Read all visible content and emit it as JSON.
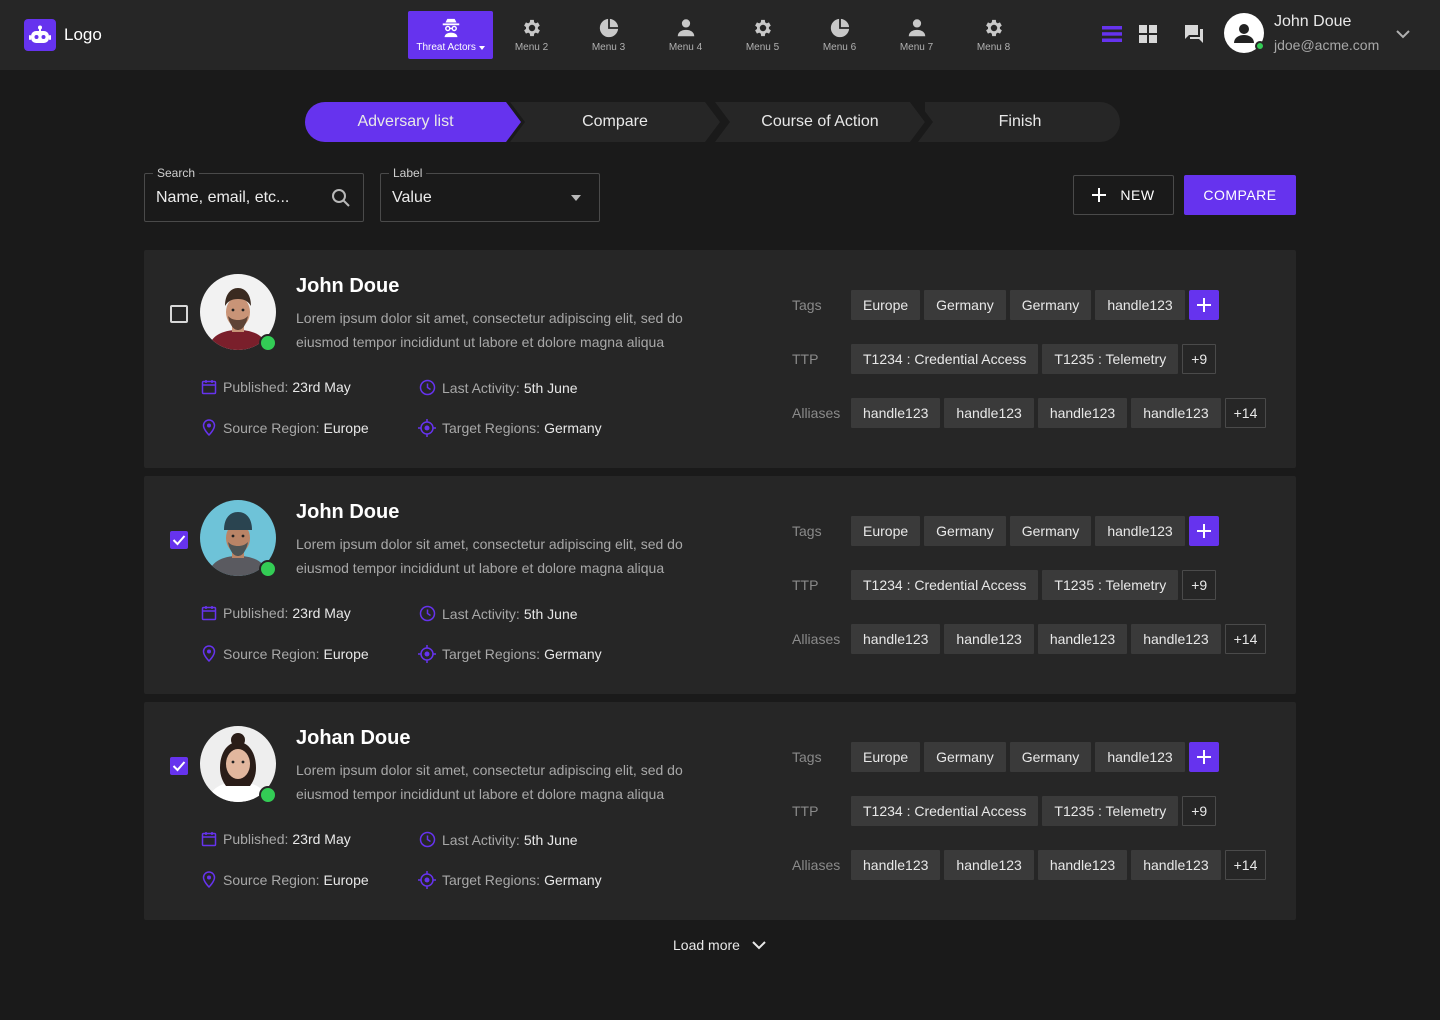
{
  "app": {
    "logo_text": "Logo"
  },
  "nav": {
    "items": [
      {
        "label": "Threat Actors",
        "icon": "spy-icon",
        "active": true
      },
      {
        "label": "Menu 2",
        "icon": "gear-icon"
      },
      {
        "label": "Menu 3",
        "icon": "pie-chart-icon"
      },
      {
        "label": "Menu 4",
        "icon": "person-icon"
      },
      {
        "label": "Menu 5",
        "icon": "gear-icon"
      },
      {
        "label": "Menu 6",
        "icon": "pie-chart-icon"
      },
      {
        "label": "Menu 7",
        "icon": "person-icon"
      },
      {
        "label": "Menu 8",
        "icon": "gear-icon"
      }
    ]
  },
  "user": {
    "name": "John Doue",
    "email": "jdoe@acme.com",
    "online": true
  },
  "stepper": {
    "steps": [
      "Adversary list",
      "Compare",
      "Course of Action",
      "Finish"
    ],
    "active_index": 0
  },
  "filters": {
    "search_label": "Search",
    "search_placeholder": "Name, email, etc...",
    "label_label": "Label",
    "label_value": "Value"
  },
  "actions": {
    "new_label": "NEW",
    "compare_label": "COMPARE"
  },
  "field_labels": {
    "published": "Published:",
    "last_activity": "Last Activity:",
    "source_region": "Source Region:",
    "target_regions": "Target Regions:",
    "tags": "Tags",
    "ttp": "TTP",
    "aliases": "Alliases"
  },
  "adversaries": [
    {
      "name": "John Doue",
      "checked": false,
      "description": "Lorem ipsum dolor sit amet, consectetur adipiscing elit, sed do eiusmod tempor incididunt ut labore et dolore magna aliqua",
      "published": "23rd May",
      "last_activity": "5th June",
      "source_region": "Europe",
      "target_regions": "Germany",
      "tags": [
        "Europe",
        "Germany",
        "Germany",
        "handle123"
      ],
      "ttp": [
        "T1234 : Credential Access",
        "T1235 : Telemetry"
      ],
      "ttp_more": "+9",
      "aliases": [
        "handle123",
        "handle123",
        "handle123",
        "handle123"
      ],
      "aliases_more": "+14",
      "avatar_colors": {
        "bg": "#f2f2f2",
        "skin": "#c99477",
        "hair": "#3a2a20",
        "shirt": "#7a1f2b"
      }
    },
    {
      "name": "John Doue",
      "checked": true,
      "description": "Lorem ipsum dolor sit amet, consectetur adipiscing elit, sed do eiusmod tempor incididunt ut labore et dolore magna aliqua",
      "published": "23rd May",
      "last_activity": "5th June",
      "source_region": "Europe",
      "target_regions": "Germany",
      "tags": [
        "Europe",
        "Germany",
        "Germany",
        "handle123"
      ],
      "ttp": [
        "T1234 : Credential Access",
        "T1235 : Telemetry"
      ],
      "ttp_more": "+9",
      "aliases": [
        "handle123",
        "handle123",
        "handle123",
        "handle123"
      ],
      "aliases_more": "+14",
      "avatar_colors": {
        "bg": "#6ec3d8",
        "skin": "#b98466",
        "hair": "#2a4450",
        "shirt": "#5a5a60"
      }
    },
    {
      "name": "Johan Doue",
      "checked": true,
      "description": "Lorem ipsum dolor sit amet, consectetur adipiscing elit, sed do eiusmod tempor incididunt ut labore et dolore magna aliqua",
      "published": "23rd May",
      "last_activity": "5th June",
      "source_region": "Europe",
      "target_regions": "Germany",
      "tags": [
        "Europe",
        "Germany",
        "Germany",
        "handle123"
      ],
      "ttp": [
        "T1234 : Credential Access",
        "T1235 : Telemetry"
      ],
      "ttp_more": "+9",
      "aliases": [
        "handle123",
        "handle123",
        "handle123",
        "handle123"
      ],
      "aliases_more": "+14",
      "avatar_colors": {
        "bg": "#eeeeee",
        "skin": "#e2b79e",
        "hair": "#2a1d18",
        "shirt": "#ffffff"
      }
    }
  ],
  "footer": {
    "load_more": "Load more"
  },
  "colors": {
    "accent": "#6633ee",
    "online": "#33cc55",
    "background": "#1a1a1a",
    "surface": "#262626",
    "chip": "#3a3a3a"
  }
}
